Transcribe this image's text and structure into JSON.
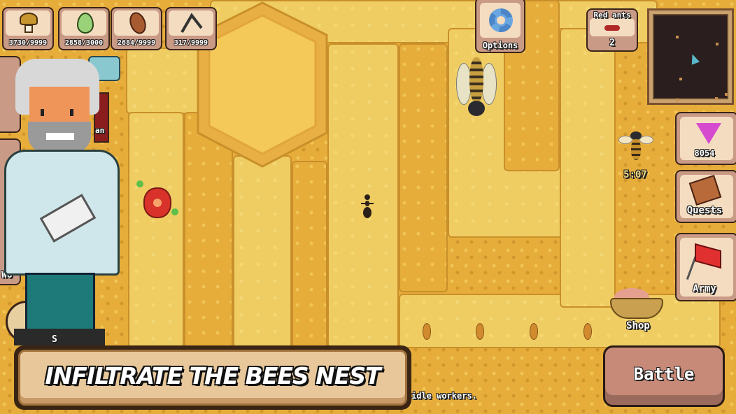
{
  "resources": [
    {
      "icon": "mushroom-icon",
      "value": "3730/9999"
    },
    {
      "icon": "leaf-icon",
      "value": "2858/3000"
    },
    {
      "icon": "almond-seed-icon",
      "value": "2684/9999"
    },
    {
      "icon": "twig-icon",
      "value": "317/9999"
    }
  ],
  "options": {
    "label": "Options",
    "icon": "gear-icon"
  },
  "enemy": {
    "label": "Red ants",
    "count": "2",
    "icon": "red-ant-icon"
  },
  "minimap": {
    "icon": "player-arrow-icon"
  },
  "gems": {
    "value": "8054",
    "icon": "gem-icon"
  },
  "quests": {
    "label": "Quests",
    "icon": "quest-book-icon"
  },
  "army": {
    "label": "Army",
    "icon": "red-flag-icon"
  },
  "bee_timer": "5:07",
  "shop": {
    "label": "Shop",
    "icon": "basket-icon"
  },
  "battle": {
    "label": "Battle"
  },
  "banner": {
    "text": "INFILTRATE THE BEES NEST"
  },
  "hint_text": "idle workers.",
  "partial_left": {
    "frag1": "an",
    "frag2": "Wo",
    "frag3": "S"
  },
  "colors": {
    "honeycomb": "#e6ad3a",
    "corridor": "#efcd62",
    "button": "#c99a86",
    "panel": "#f4dcc0"
  }
}
